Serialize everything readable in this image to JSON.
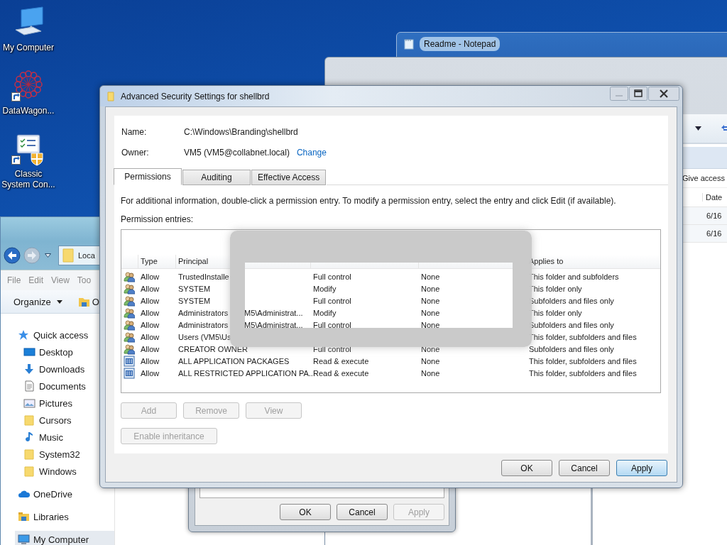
{
  "desktop_icons": [
    {
      "label": "My Computer",
      "kind": "computer",
      "shortcut": false
    },
    {
      "label": "DataWagon...",
      "kind": "network",
      "shortcut": true
    },
    {
      "label": "Classic System Con...",
      "kind": "control-panel",
      "shortcut": true
    }
  ],
  "explorer_window": {
    "address": "Loca",
    "menu": [
      "File",
      "Edit",
      "View",
      "Too"
    ],
    "organize": "Organize",
    "toolbar_item": "O",
    "nav": [
      {
        "label": "Quick access",
        "kind": "star",
        "selected": false,
        "children": [
          {
            "label": "Desktop",
            "kind": "desktop",
            "selected": false
          },
          {
            "label": "Downloads",
            "kind": "download",
            "selected": false
          },
          {
            "label": "Documents",
            "kind": "document",
            "selected": false
          },
          {
            "label": "Pictures",
            "kind": "pictures",
            "selected": false
          },
          {
            "label": "Cursors",
            "kind": "folder",
            "selected": false
          },
          {
            "label": "Music",
            "kind": "music",
            "selected": false
          },
          {
            "label": "System32",
            "kind": "folder",
            "selected": false
          },
          {
            "label": "Windows",
            "kind": "folder",
            "selected": false
          }
        ]
      },
      {
        "label": "OneDrive",
        "kind": "cloud",
        "selected": false
      },
      {
        "label": "Libraries",
        "kind": "library",
        "selected": false
      },
      {
        "label": "My Computer",
        "kind": "computer",
        "selected": true
      }
    ]
  },
  "notepad_window": {
    "title": "Readme - Notepad"
  },
  "folder_window": {
    "toolbar_item": "Give access",
    "column": "Date",
    "rows": [
      "6/16",
      "6/16"
    ]
  },
  "properties_dialog": {
    "buttons": [
      {
        "label": "OK",
        "disabled": false
      },
      {
        "label": "Cancel",
        "disabled": false
      },
      {
        "label": "Apply",
        "disabled": true
      }
    ]
  },
  "dialog": {
    "title": "Advanced Security Settings for shellbrd",
    "name_label": "Name:",
    "name": "C:\\Windows\\Branding\\shellbrd",
    "owner_label": "Owner:",
    "owner": "VM5 (VM5@collabnet.local)",
    "change_link": "Change",
    "tabs": [
      {
        "label": "Permissions",
        "selected": true
      },
      {
        "label": "Auditing",
        "selected": false
      },
      {
        "label": "Effective Access",
        "selected": false
      }
    ],
    "info": "For additional information, double-click a permission entry. To modify a permission entry, select the entry and click Edit (if available).",
    "entries_label": "Permission entries:",
    "columns": [
      {
        "label": "Type"
      },
      {
        "label": "Principal"
      },
      {},
      {},
      {
        "label": "Applies to"
      }
    ],
    "rows": [
      {
        "kind": "group",
        "type": "Allow",
        "principal": "TrustedInstalle",
        "access": "Full control",
        "inherited": "None",
        "applies": "This folder and subfolders"
      },
      {
        "kind": "group",
        "type": "Allow",
        "principal": "SYSTEM",
        "access": "Modify",
        "inherited": "None",
        "applies": "This folder only"
      },
      {
        "kind": "group",
        "type": "Allow",
        "principal": "SYSTEM",
        "access": "Full control",
        "inherited": "None",
        "applies": "Subfolders and files only"
      },
      {
        "kind": "group",
        "type": "Allow",
        "principal": "Administrators",
        "principal_end": "M5\\Administrat...",
        "access": "Modify",
        "inherited": "None",
        "applies": "This folder only"
      },
      {
        "kind": "group",
        "type": "Allow",
        "principal": "Administrators",
        "principal_end": "M5\\Administrat...",
        "access": "Full control",
        "inherited": "None",
        "applies": "Subfolders and files only"
      },
      {
        "kind": "group",
        "type": "Allow",
        "principal": "Users (VM5\\Us",
        "applies": "This folder, subfolders and files"
      },
      {
        "kind": "group",
        "type": "Allow",
        "principal": "CREATOR OWNER",
        "access": "Full control",
        "inherited": "None",
        "applies": "Subfolders and files only"
      },
      {
        "kind": "package",
        "type": "Allow",
        "principal": "ALL APPLICATION PACKAGES",
        "access": "Read & execute",
        "inherited": "None",
        "applies": "This folder, subfolders and files"
      },
      {
        "kind": "package",
        "type": "Allow",
        "principal": "ALL RESTRICTED APPLICATION PA...",
        "access": "Read & execute",
        "inherited": "None",
        "applies": "This folder, subfolders and files"
      }
    ],
    "entry_buttons": [
      {
        "label": "Add",
        "disabled": true
      },
      {
        "label": "Remove",
        "disabled": true
      },
      {
        "label": "View",
        "disabled": true
      }
    ],
    "inheritance_button": {
      "label": "Enable inheritance",
      "disabled": true
    },
    "buttons": [
      {
        "label": "OK",
        "default": false
      },
      {
        "label": "Cancel",
        "default": false
      },
      {
        "label": "Apply",
        "default": true
      }
    ]
  }
}
